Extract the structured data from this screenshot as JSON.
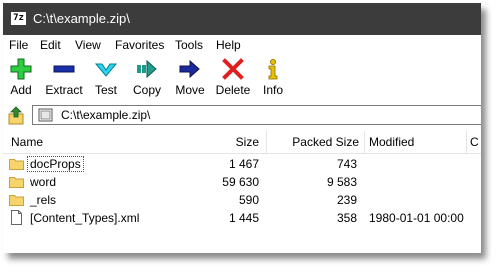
{
  "window": {
    "title": "C:\\t\\example.zip\\",
    "app_icon_text": "7z"
  },
  "menu": [
    "File",
    "Edit",
    "View",
    "Favorites",
    "Tools",
    "Help"
  ],
  "toolbar": {
    "add": "Add",
    "extract": "Extract",
    "test": "Test",
    "copy": "Copy",
    "move": "Move",
    "delete": "Delete",
    "info": "Info"
  },
  "address": {
    "path": "C:\\t\\example.zip\\"
  },
  "columns": {
    "name": "Name",
    "size": "Size",
    "packed": "Packed Size",
    "modified": "Modified",
    "extra": "C"
  },
  "files": [
    {
      "name": "docProps",
      "size": "1 467",
      "packed": "743",
      "modified": "",
      "type": "folder"
    },
    {
      "name": "word",
      "size": "59 630",
      "packed": "9 583",
      "modified": "",
      "type": "folder"
    },
    {
      "name": "_rels",
      "size": "590",
      "packed": "239",
      "modified": "",
      "type": "folder"
    },
    {
      "name": "[Content_Types].xml",
      "size": "1 445",
      "packed": "358",
      "modified": "1980-01-01 00:00",
      "type": "file"
    }
  ],
  "colors": {
    "titlebar": "#3c3c3c",
    "folder": "#f6d36b",
    "add": "#2ecc40",
    "extract": "#1a2fa8",
    "test": "#2ad4f0",
    "copy": "#1f9c8c",
    "move": "#1a2a9c",
    "delete": "#e02020",
    "info": "#e8c000"
  }
}
